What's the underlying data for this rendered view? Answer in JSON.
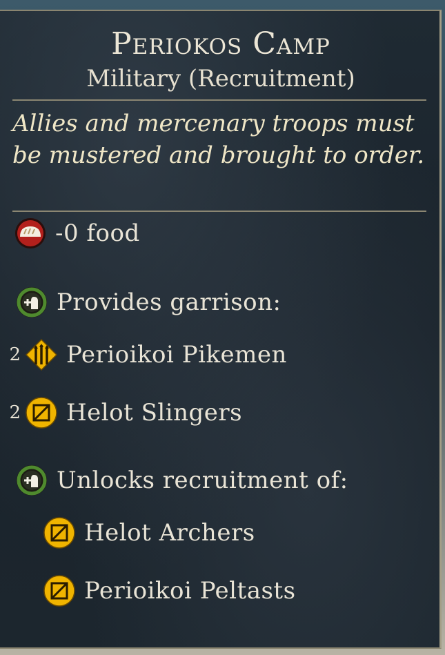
{
  "building": {
    "title": "Periokos Camp",
    "subtitle": "Military (Recruitment)",
    "description": "Allies and mercenary troops must be mustered and brought to order."
  },
  "effects": {
    "food": "-0 food",
    "garrison_header": "Provides garrison:",
    "garrison_units": [
      {
        "count": "2",
        "name": "Perioikoi Pikemen",
        "icon": "pikemen-icon"
      },
      {
        "count": "2",
        "name": "Helot Slingers",
        "icon": "missile-infantry-icon"
      }
    ],
    "recruitment_header": "Unlocks recruitment of:",
    "recruitment_units": [
      {
        "name": "Helot Archers",
        "icon": "missile-infantry-icon"
      },
      {
        "name": "Perioikoi Peltasts",
        "icon": "missile-infantry-icon"
      }
    ]
  },
  "colors": {
    "unit_icon_gold": "#f0b400",
    "food_icon_red": "#b3201c",
    "garrison_icon_green": "#4f8a2e"
  }
}
